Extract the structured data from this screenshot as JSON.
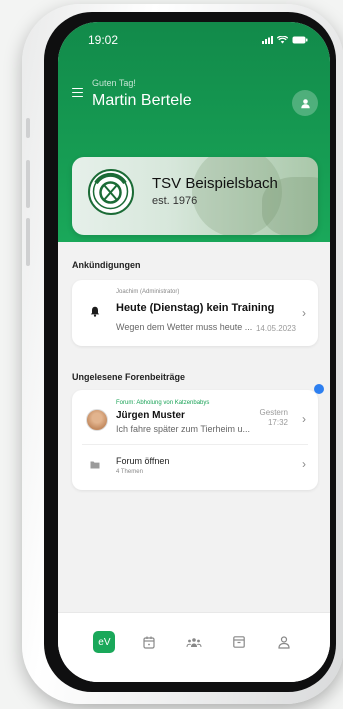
{
  "status_bar": {
    "time": "19:02"
  },
  "header": {
    "greeting": "Guten Tag!",
    "user_name": "Martin Bertele"
  },
  "club": {
    "name": "TSV Beispielsbach",
    "established": "est. 1976"
  },
  "announcements": {
    "section_title": "Ankündigungen",
    "item": {
      "author": "Joachim (Administrator)",
      "title": "Heute (Dienstag) kein Training",
      "preview": "Wegen dem Wetter muss heute ...",
      "date": "14.05.2023"
    }
  },
  "forum": {
    "section_title": "Ungelesene Forenbeiträge",
    "post": {
      "thread": "Forum: Abholung von Katzenbabys",
      "author": "Jürgen Muster",
      "preview": "Ich fahre später zum Tierheim u...",
      "time_day": "Gestern",
      "time_hour": "17:32"
    },
    "open": {
      "label": "Forum öffnen",
      "count": "4 Themen"
    }
  },
  "tabbar": {
    "home_label": "eV",
    "icons": [
      "calendar-icon",
      "members-icon",
      "archive-icon",
      "profile-icon"
    ]
  },
  "colors": {
    "brand_green": "#1aa85a",
    "notification_blue": "#2d7ff0"
  }
}
